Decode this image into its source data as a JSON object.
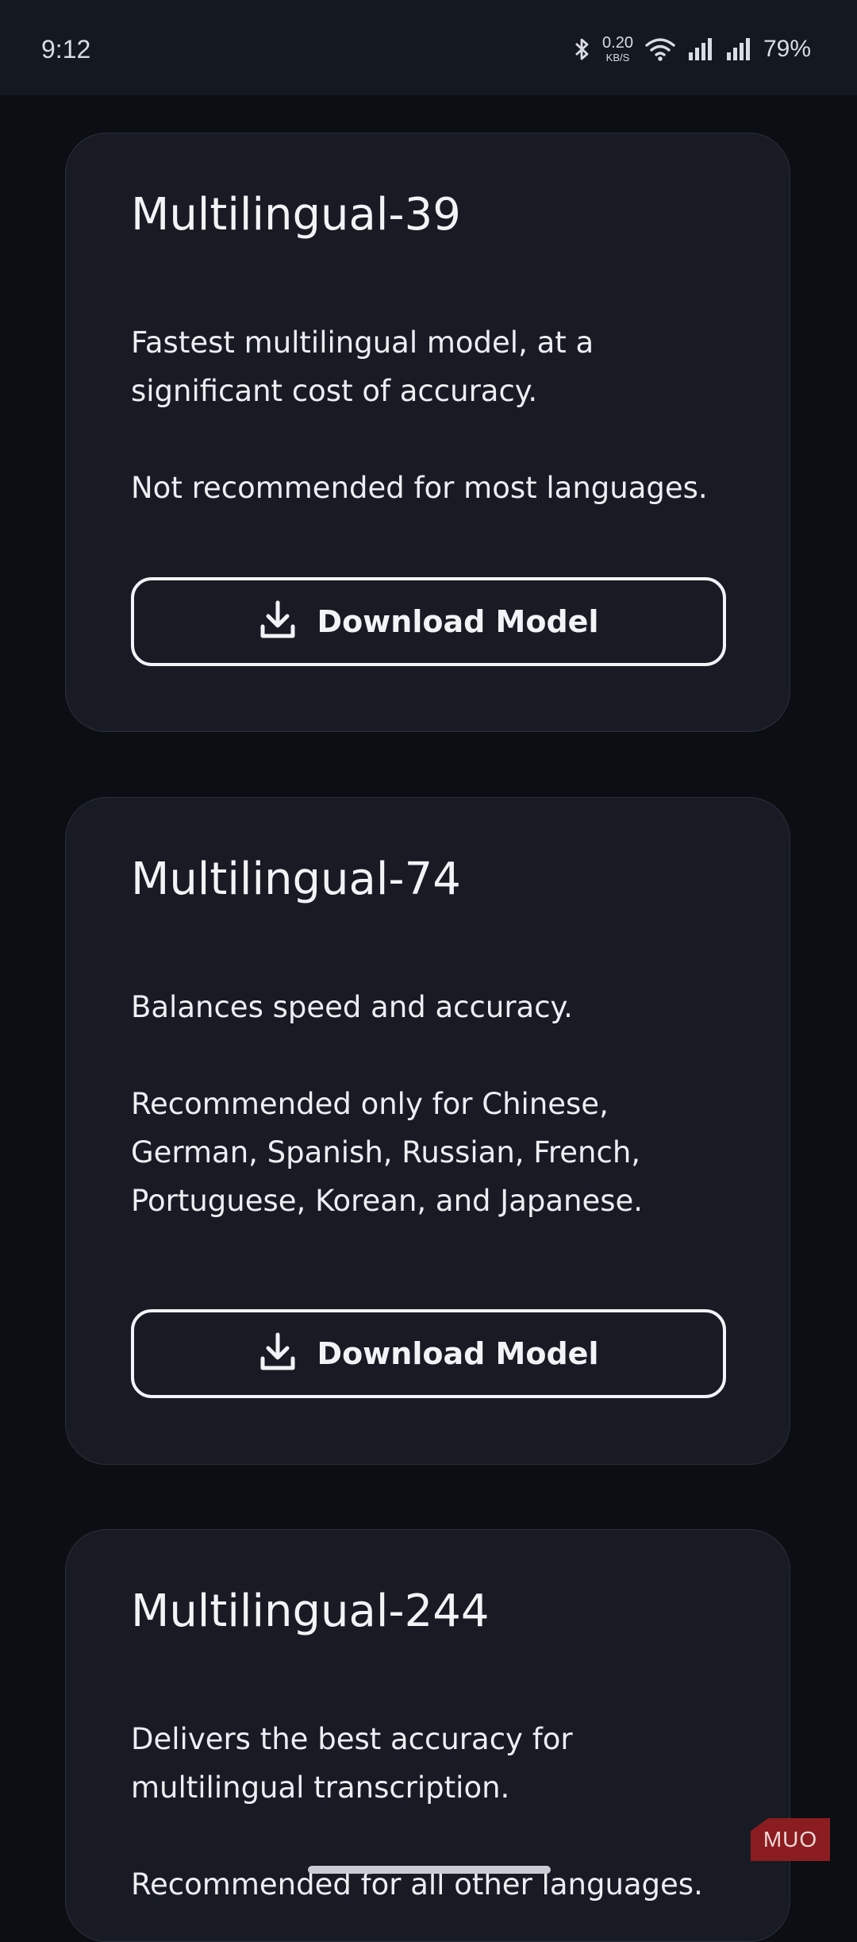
{
  "status_bar": {
    "time": "9:12",
    "net_speed_value": "0.20",
    "net_speed_unit": "KB/S",
    "battery": "79%",
    "icons": [
      "bluetooth-icon",
      "wifi-icon",
      "signal-icon",
      "signal-icon",
      "battery-text"
    ]
  },
  "cards": [
    {
      "title": "Multilingual-39",
      "desc1": "Fastest multilingual model, at a significant cost of accuracy.",
      "desc2": "Not recommended for most languages.",
      "button": "Download Model"
    },
    {
      "title": "Multilingual-74",
      "desc1": "Balances speed and accuracy.",
      "desc2": "Recommended only for Chinese, German, Spanish, Russian, French, Portuguese, Korean, and Japanese.",
      "button": "Download Model"
    },
    {
      "title": "Multilingual-244",
      "desc1": "Delivers the best accuracy for multilingual transcription.",
      "desc2": "Recommended for all other languages."
    }
  ],
  "watermark": "MUO",
  "colors": {
    "background": "#0b0e13",
    "card": "#181b23",
    "card_border": "#2a2f3a",
    "text": "#f2f3f6",
    "watermark": "#8b1c1f"
  }
}
